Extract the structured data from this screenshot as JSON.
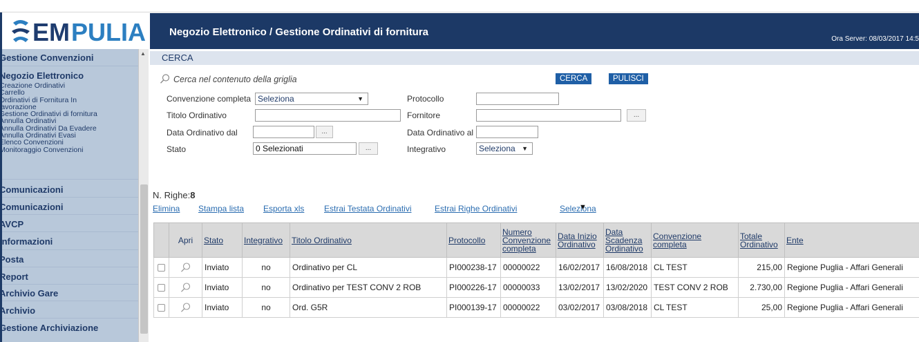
{
  "logo": {
    "part1": "EM",
    "part2": "PULIA"
  },
  "header": {
    "title": "Negozio Elettronico / Gestione Ordinativi di fornitura",
    "server_time": "Ora Server: 08/03/2017 14:5"
  },
  "sidebar": {
    "sections": [
      {
        "label": "Gestione Convenzioni",
        "items": []
      },
      {
        "label": "Negozio Elettronico",
        "items": [
          "Creazione Ordinativi",
          "Carrello",
          "Ordinativi di Fornitura In",
          "lavorazione",
          "Gestione Ordinativi di fornitura",
          "Annulla Ordinativi",
          "Annulla Ordinativi Da Evadere",
          "Annulla Ordinativi Evasi",
          "Elenco Convenzioni",
          "Monitoraggio Convenzioni"
        ]
      },
      {
        "label": "Comunicazioni",
        "items": []
      },
      {
        "label": "Comunicazioni",
        "items": []
      },
      {
        "label": "AVCP",
        "items": []
      },
      {
        "label": "Informazioni",
        "items": []
      },
      {
        "label": "Posta",
        "items": []
      },
      {
        "label": "Report",
        "items": []
      },
      {
        "label": "Archivio Gare",
        "items": []
      },
      {
        "label": "Archivio",
        "items": []
      },
      {
        "label": "Gestione Archiviazione",
        "items": []
      }
    ]
  },
  "search": {
    "section_title": "CERCA",
    "grid_search_label": "Cerca nel contenuto della griglia",
    "cerca_button": "CERCA",
    "pulisci_button": "PULISCI",
    "convenzione_label": "Convenzione completa",
    "convenzione_value": "Seleziona",
    "protocollo_label": "Protocollo",
    "protocollo_value": "",
    "titolo_label": "Titolo Ordinativo",
    "titolo_value": "",
    "fornitore_label": "Fornitore",
    "fornitore_value": "",
    "data_dal_label": "Data Ordinativo dal",
    "data_dal_value": "",
    "data_al_label": "Data Ordinativo al",
    "data_al_value": "",
    "stato_label": "Stato",
    "stato_value": "0 Selezionati",
    "integrativo_label": "Integrativo",
    "integrativo_value": "Seleziona",
    "dots": "..."
  },
  "results": {
    "count_label": "N. Righe:",
    "count": "8",
    "actions": [
      "Elimina",
      "Stampa lista",
      "Esporta xls",
      "Estrai Testata Ordinativi",
      "Estrai Righe Ordinativi",
      "Seleziona"
    ]
  },
  "table": {
    "headers": [
      "Apri",
      "Stato",
      "Integrativo",
      "Titolo Ordinativo",
      "Protocollo",
      "Numero Convenzione completa",
      "Data Inizio Ordinativo",
      "Data Scadenza Ordinativo",
      "Convenzione completa",
      "Totale Ordinativo",
      "Ente"
    ],
    "rows": [
      {
        "stato": "Inviato",
        "integrativo": "no",
        "titolo": "Ordinativo per CL",
        "protocollo": "PI000238-17",
        "numero": "00000022",
        "inizio": "16/02/2017",
        "scadenza": "16/08/2018",
        "convenzione": "CL TEST",
        "totale": "215,00",
        "ente": "Regione Puglia - Affari Generali"
      },
      {
        "stato": "Inviato",
        "integrativo": "no",
        "titolo": "Ordinativo per TEST CONV 2 ROB",
        "protocollo": "PI000226-17",
        "numero": "00000033",
        "inizio": "13/02/2017",
        "scadenza": "13/02/2020",
        "convenzione": "TEST CONV 2 ROB",
        "totale": "2.730,00",
        "ente": "Regione Puglia - Affari Generali"
      },
      {
        "stato": "Inviato",
        "integrativo": "no",
        "titolo": "Ord. G5R",
        "protocollo": "PI000139-17",
        "numero": "00000022",
        "inizio": "03/02/2017",
        "scadenza": "03/08/2018",
        "convenzione": "CL TEST",
        "totale": "25,00",
        "ente": "Regione Puglia - Affari Generali"
      }
    ]
  }
}
